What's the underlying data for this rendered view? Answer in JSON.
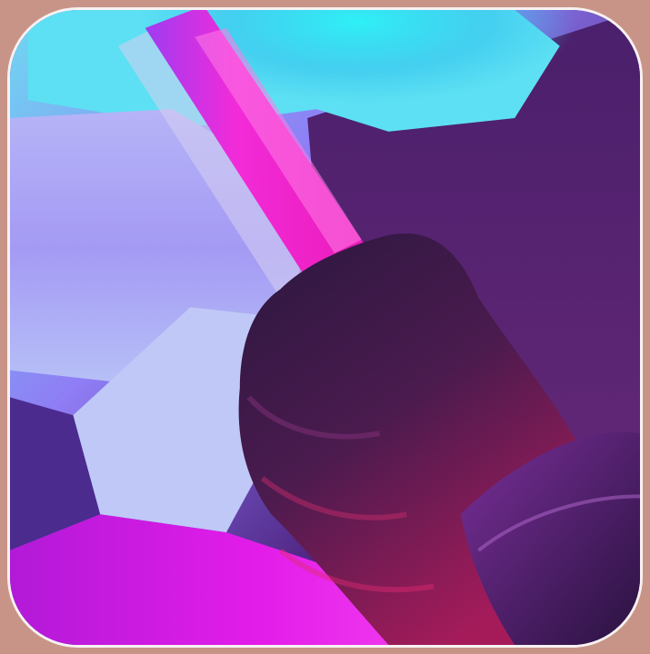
{
  "image": {
    "subject": "hand-holding-glowing-tube",
    "colors": {
      "background": "#c99488",
      "border": "#f7f2f2",
      "cyan": "#2ef0f5",
      "violet": "#8f6df0",
      "magenta": "#e31ce9",
      "deep_purple": "#3a1552"
    }
  }
}
